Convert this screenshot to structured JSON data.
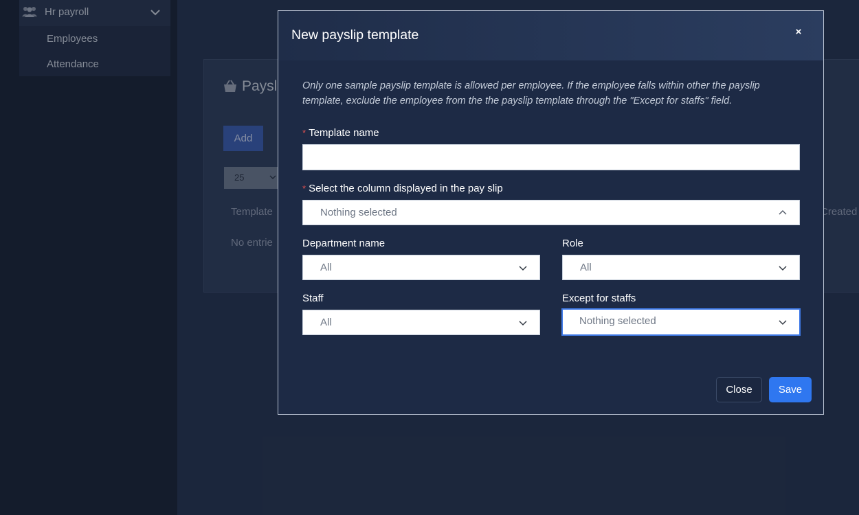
{
  "sidebar": {
    "group_label": "Hr payroll",
    "items": [
      {
        "label": "Employees"
      },
      {
        "label": "Attendance"
      }
    ]
  },
  "background": {
    "panel_title": "Paysl",
    "add_label": "Add",
    "page_length": "25",
    "column_left": "Template",
    "column_right": "Created",
    "empty_text": "No entrie"
  },
  "modal": {
    "title": "New payslip template",
    "close_icon": "×",
    "note": "Only one sample payslip template is allowed per employee. If the employee falls within other the payslip template, exclude the employee from the the payslip template through the \"Except for staffs\" field.",
    "required_mark": "*",
    "template_name_label": "Template name",
    "template_name_value": "",
    "columns_label": "Select the column displayed in the pay slip",
    "columns_value": "Nothing selected",
    "department_label": "Department name",
    "department_value": "All",
    "role_label": "Role",
    "role_value": "All",
    "staff_label": "Staff",
    "staff_value": "All",
    "except_label": "Except for staffs",
    "except_value": "Nothing selected",
    "close_label": "Close",
    "save_label": "Save"
  },
  "colors": {
    "accent": "#2f77f0",
    "required": "#e05050",
    "modal_bg": "#1d2a45"
  }
}
